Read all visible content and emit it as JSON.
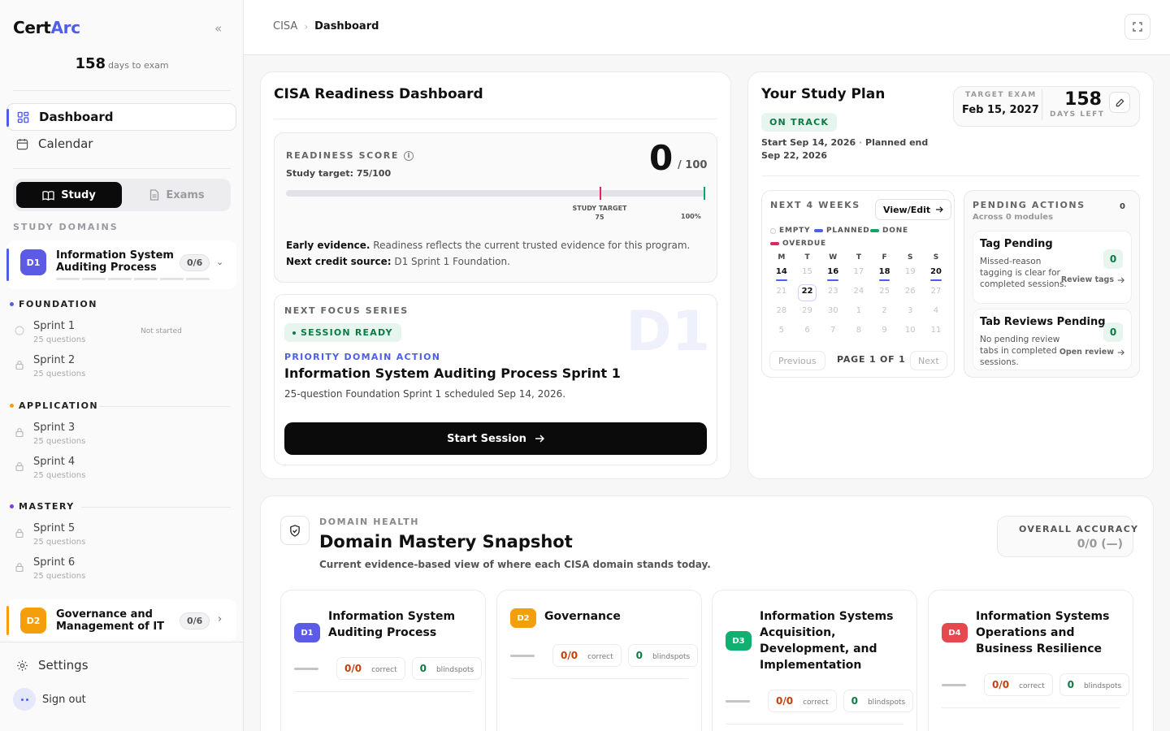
{
  "app": {
    "brand_a": "Cert",
    "brand_b": "Arc",
    "days": "158",
    "days_label": "days to exam"
  },
  "nav": {
    "dashboard": "Dashboard",
    "calendar": "Calendar",
    "settings": "Settings",
    "signout": "Sign out"
  },
  "toggle": {
    "study": "Study",
    "exams": "Exams"
  },
  "sidebar": {
    "study_domains": "STUDY DOMAINS",
    "domain1": {
      "badge": "D1",
      "title": "Information System Auditing Process",
      "count": "0/6"
    },
    "domain2": {
      "badge": "D2",
      "title": "Governance and Management of IT",
      "count": "0/6"
    },
    "phases": {
      "foundation": {
        "label": "FOUNDATION",
        "sprints": [
          {
            "name": "Sprint 1",
            "q": "25 questions",
            "status": "Not started"
          },
          {
            "name": "Sprint 2",
            "q": "25 questions"
          }
        ]
      },
      "application": {
        "label": "APPLICATION",
        "sprints": [
          {
            "name": "Sprint 3",
            "q": "25 questions"
          },
          {
            "name": "Sprint 4",
            "q": "25 questions"
          }
        ]
      },
      "mastery": {
        "label": "MASTERY",
        "sprints": [
          {
            "name": "Sprint 5",
            "q": "25 questions"
          },
          {
            "name": "Sprint 6",
            "q": "25 questions"
          }
        ]
      }
    }
  },
  "header": {
    "crumb_root": "CISA",
    "crumb_current": "Dashboard"
  },
  "readiness": {
    "title": "CISA Readiness Dashboard",
    "score_label": "READINESS SCORE",
    "target_text": "Study target: 75/100",
    "score": "0",
    "score_max": "/ 100",
    "score_fraction": 0,
    "target_fraction": 0.75,
    "target_marker": "STUDY TARGET",
    "target_value": "75",
    "max_label": "100%",
    "evidence_bold": "Early evidence.",
    "evidence_text": " Readiness reflects the current trusted evidence for this program. ",
    "next_bold": "Next credit source:",
    "next_text": " D1 Sprint 1 Foundation."
  },
  "focus": {
    "label": "NEXT FOCUS SERIES",
    "pill": "SESSION READY",
    "watermark": "D1",
    "priority": "PRIORITY DOMAIN ACTION",
    "title": "Information System Auditing Process Sprint 1",
    "desc": "25-question Foundation Sprint 1 scheduled Sep 14, 2026.",
    "button": "Start Session"
  },
  "plan": {
    "title": "Your Study Plan",
    "status": "ON TRACK",
    "start": "Start Sep 14, 2026",
    "sep": "·",
    "end_label": "Planned end",
    "end": "Sep 22, 2026",
    "target_label": "TARGET EXAM",
    "target_date": "Feb 15, 2027",
    "days": "158",
    "days_label": "DAYS LEFT"
  },
  "calendar": {
    "title": "NEXT 4 WEEKS",
    "view_edit": "View/Edit",
    "legend": {
      "empty": "EMPTY",
      "planned": "PLANNED",
      "done": "DONE",
      "overdue": "OVERDUE"
    },
    "colors": {
      "planned": "#4f5ee6",
      "done": "#14a366",
      "overdue": "#e0245e"
    },
    "weekdays": [
      "M",
      "T",
      "W",
      "T",
      "F",
      "S",
      "S"
    ],
    "weeks": [
      [
        "14",
        "15",
        "16",
        "17",
        "18",
        "19",
        "20"
      ],
      [
        "21",
        "22",
        "23",
        "24",
        "25",
        "26",
        "27"
      ],
      [
        "28",
        "29",
        "30",
        "1",
        "2",
        "3",
        "4"
      ],
      [
        "5",
        "6",
        "7",
        "8",
        "9",
        "10",
        "11"
      ]
    ],
    "planned_days": [
      "14",
      "16",
      "18",
      "20"
    ],
    "today": "22",
    "prev": "Previous",
    "page": "PAGE 1 OF 1",
    "next": "Next"
  },
  "pending": {
    "title": "PENDING ACTIONS",
    "count": "0",
    "sub": "Across 0 modules",
    "items": [
      {
        "title": "Tag Pending",
        "desc": "Missed-reason tagging is clear for completed sessions.",
        "count": "0",
        "action": "Review tags"
      },
      {
        "title": "Tab Reviews Pending",
        "desc": "No pending review tabs in completed sessions.",
        "count": "0",
        "action": "Open review"
      }
    ]
  },
  "health": {
    "cap": "DOMAIN HEALTH",
    "title": "Domain Mastery Snapshot",
    "subtitle": "Current evidence-based view of where each CISA domain stands today.",
    "acc_label": "OVERALL ACCURACY",
    "acc_value": "0/0 (—)",
    "domains": [
      {
        "badge": "D1",
        "color": "#5b5be6",
        "title": "Information System Auditing Process",
        "correct": "0/0",
        "correct_label": "correct",
        "blind": "0",
        "blind_label": "blindspots"
      },
      {
        "badge": "D2",
        "color": "#f59e0b",
        "title": "Governance",
        "correct": "0/0",
        "correct_label": "correct",
        "blind": "0",
        "blind_label": "blindspots"
      },
      {
        "badge": "D3",
        "color": "#10b070",
        "title": "Information Systems Acquisition, Development, and Implementation",
        "correct": "0/0",
        "correct_label": "correct",
        "blind": "0",
        "blind_label": "blindspots"
      },
      {
        "badge": "D4",
        "color": "#e5484d",
        "title": "Information Systems Operations and Business Resilience",
        "correct": "0/0",
        "correct_label": "correct",
        "blind": "0",
        "blind_label": "blindspots"
      }
    ]
  },
  "colors": {
    "accent": "#4f5ee6",
    "foundation": "#4f5ee6",
    "application": "#f59e0b",
    "mastery": "#7c3aed",
    "zero": "#c2410c"
  }
}
